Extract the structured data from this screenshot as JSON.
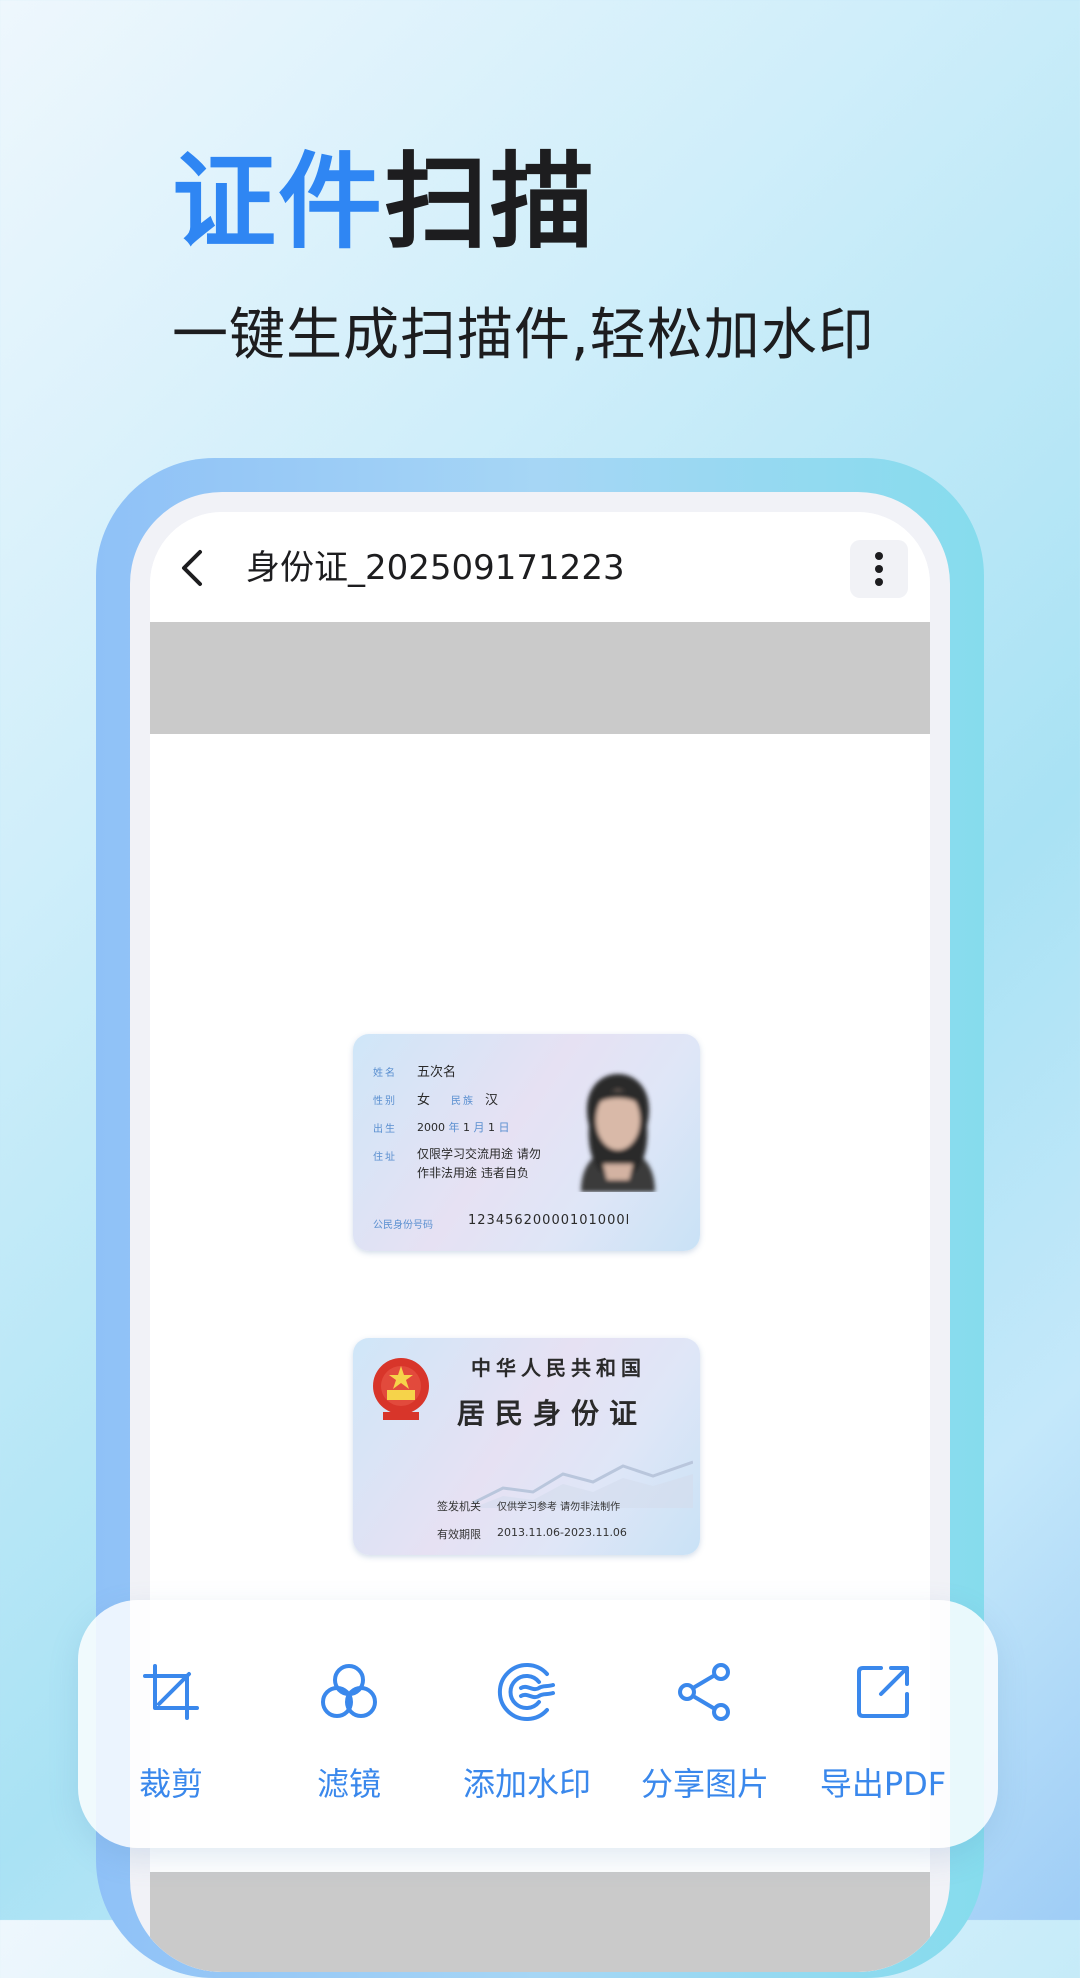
{
  "headline": {
    "part1": "证件",
    "part2": "扫描"
  },
  "subtitle": "一键生成扫描件,轻松加水印",
  "doc_title": "身份证_202509171223",
  "id_front": {
    "labels": {
      "name": "姓名",
      "sex": "性别",
      "ethnicity": "民族",
      "birth": "出生",
      "address": "住址",
      "id_number": "公民身份号码"
    },
    "name": "五次名",
    "sex": "女",
    "ethnicity": "汉",
    "birth_year": "2000",
    "year_unit": "年",
    "birth_month": "1",
    "month_unit": "月",
    "birth_day": "1",
    "day_unit": "日",
    "address_line1": "仅限学习交流用途 请勿",
    "address_line2": "作非法用途 违者自负",
    "id_number": "12345620000101000l"
  },
  "id_back": {
    "title1": "中华人民共和国",
    "title2": "居民身份证",
    "authority_label": "签发机关",
    "authority_value": "仅供学习参考 请勿非法制作",
    "validity_label": "有效期限",
    "validity_value": "2013.11.06-2023.11.06"
  },
  "toolbar": [
    {
      "label": "裁剪",
      "icon": "crop-icon"
    },
    {
      "label": "滤镜",
      "icon": "filter-icon"
    },
    {
      "label": "添加水印",
      "icon": "watermark-icon"
    },
    {
      "label": "分享图片",
      "icon": "share-icon"
    },
    {
      "label": "导出PDF",
      "icon": "export-icon"
    }
  ],
  "colors": {
    "accent": "#2f86f3",
    "toolbar_text": "#3a88ec",
    "title_dark": "#1d1d1f"
  }
}
